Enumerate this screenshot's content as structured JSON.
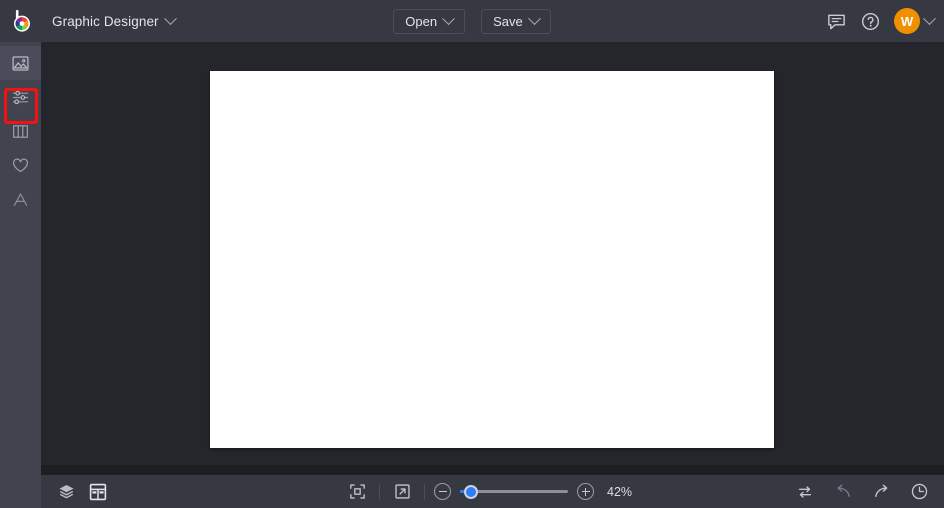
{
  "header": {
    "logo_icon": "bepic-color-wheel-logo",
    "app_title": "Graphic Designer",
    "title_chevron_icon": "chevron-down-icon",
    "open_label": "Open",
    "open_chevron_icon": "chevron-down-icon",
    "save_label": "Save",
    "save_chevron_icon": "chevron-down-icon",
    "feedback_icon": "chat-bubble-icon",
    "help_icon": "help-circle-icon",
    "avatar_initial": "W",
    "avatar_chevron_icon": "chevron-down-icon",
    "avatar_color": "#f09000",
    "background_color": "#363842"
  },
  "sidebar": {
    "background_color": "#41434f",
    "highlight_color": "#f41212",
    "items": [
      {
        "name": "image",
        "icon": "image-icon",
        "active": true,
        "highlighted": true
      },
      {
        "name": "adjust",
        "icon": "sliders-icon",
        "active": false,
        "highlighted": false
      },
      {
        "name": "columns",
        "icon": "columns-icon",
        "active": false,
        "highlighted": false
      },
      {
        "name": "favorites",
        "icon": "heart-icon",
        "active": false,
        "highlighted": false
      },
      {
        "name": "text",
        "icon": "text-a-icon",
        "active": false,
        "highlighted": false
      }
    ]
  },
  "workspace": {
    "background_color": "#24262b",
    "canvas_color": "#ffffff"
  },
  "bottombar": {
    "background_color": "#363842",
    "layers_icon": "layers-icon",
    "panel_layout_icon": "panel-layout-icon",
    "fit_screen_icon": "fit-to-screen-icon",
    "fullscreen_icon": "expand-arrow-icon",
    "zoom_out_icon": "minus-circle-icon",
    "zoom_in_icon": "plus-circle-icon",
    "zoom_level": "42%",
    "zoom_slider_value": 4,
    "slider_accent_color": "#2d7ff9",
    "compare_icon": "swap-arrows-icon",
    "undo_icon": "undo-arrow-icon",
    "redo_icon": "redo-arrow-icon",
    "history_icon": "clock-history-icon"
  }
}
